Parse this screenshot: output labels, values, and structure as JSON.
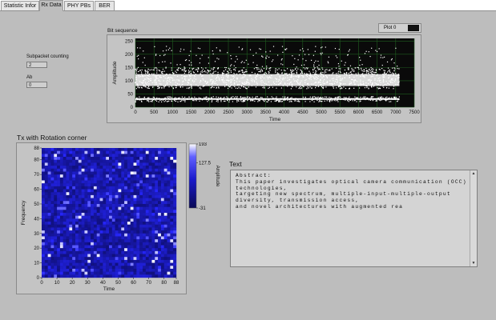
{
  "tabs": [
    {
      "label": "Statistic Infor",
      "active": false
    },
    {
      "label": "Rx Data",
      "active": true
    },
    {
      "label": "PHY PBs",
      "active": false
    },
    {
      "label": "BER",
      "active": false
    }
  ],
  "indicators": {
    "subpacket_label": "Subpacket counting",
    "subpacket_value": "2",
    "ab_label": "Ab",
    "ab_value": "0"
  },
  "plot_legend": {
    "label": "Plot 0"
  },
  "text_panel": {
    "title": "Text",
    "content": "Abstract:\nThis paper investigates optical camera communication (OCC) technologies,\ntargeting new spectrum, multiple-input-multiple-output diversity, transmission access,\nand novel architectures with augmented rea"
  },
  "colors": {
    "panel_bg": "#bdbdbd",
    "bit_plot_bg": "#0a0a0a",
    "bit_grid": "#1f5d1f",
    "bit_trace": "#ffffff",
    "intensity_low": "#0a0a55",
    "intensity_high": "#ffffff"
  },
  "chart_data": [
    {
      "type": "scatter",
      "title": "Bit sequence",
      "xlabel": "Time",
      "ylabel": "Amplitude",
      "xlim": [
        0,
        7500
      ],
      "ylim": [
        0,
        260
      ],
      "xticks": [
        0,
        500,
        1000,
        1500,
        2000,
        2500,
        3000,
        3500,
        4000,
        4500,
        5000,
        5500,
        6000,
        6500,
        7000,
        7500
      ],
      "yticks": [
        0,
        50,
        100,
        150,
        200,
        250
      ],
      "series": [
        {
          "name": "Plot 0",
          "x_range": [
            0,
            7100
          ],
          "high_band": [
            70,
            150
          ],
          "low_band": [
            20,
            40
          ],
          "peak_max": 230
        }
      ],
      "grid": true
    },
    {
      "type": "heatmap",
      "title": "Tx with Rotation corner",
      "xlabel": "Time",
      "ylabel": "Frequency",
      "xlim": [
        0,
        88
      ],
      "ylim": [
        0,
        88
      ],
      "xticks": [
        0,
        10,
        20,
        30,
        40,
        50,
        60,
        70,
        80,
        88
      ],
      "yticks": [
        0,
        10,
        20,
        30,
        40,
        50,
        60,
        70,
        80,
        88
      ],
      "colorbar": {
        "label": "Amplitude",
        "min": -31,
        "mid": 127.5,
        "max": 193,
        "tick_labels": [
          "193",
          "127.5",
          "-31"
        ]
      }
    }
  ]
}
